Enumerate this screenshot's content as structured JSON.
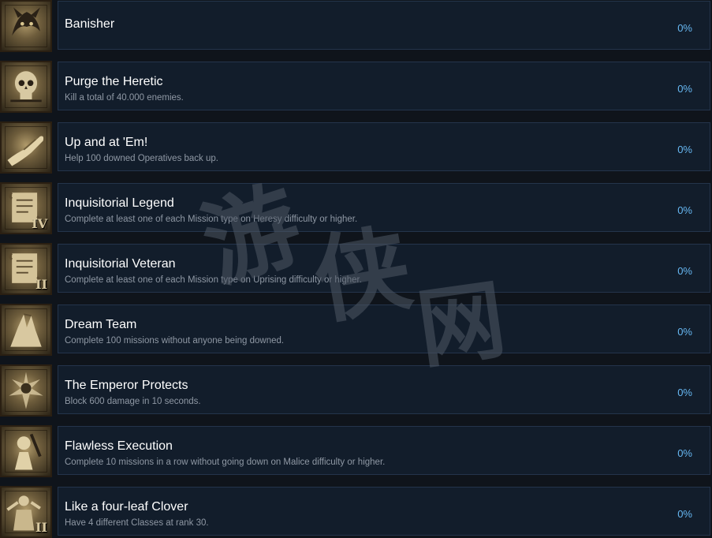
{
  "achievements": [
    {
      "title": "Banisher",
      "description": "",
      "percent": "0%",
      "icon": "daemon-icon",
      "numeral": ""
    },
    {
      "title": "Purge the Heretic",
      "description": "Kill a total of 40.000 enemies.",
      "percent": "0%",
      "icon": "skull-icon",
      "numeral": ""
    },
    {
      "title": "Up and at 'Em!",
      "description": "Help 100 downed Operatives back up.",
      "percent": "0%",
      "icon": "helping-hand-icon",
      "numeral": ""
    },
    {
      "title": "Inquisitorial Legend",
      "description": "Complete at least one of each Mission type on Heresy difficulty or higher.",
      "percent": "0%",
      "icon": "scroll-icon",
      "numeral": "IV"
    },
    {
      "title": "Inquisitorial Veteran",
      "description": "Complete at least one of each Mission type on Uprising difficulty or higher.",
      "percent": "0%",
      "icon": "scroll-icon",
      "numeral": "II"
    },
    {
      "title": "Dream Team",
      "description": "Complete 100 missions without anyone being downed.",
      "percent": "0%",
      "icon": "high-five-icon",
      "numeral": ""
    },
    {
      "title": "The Emperor Protects",
      "description": "Block 600 damage in 10 seconds.",
      "percent": "0%",
      "icon": "emperor-icon",
      "numeral": ""
    },
    {
      "title": "Flawless Execution",
      "description": "Complete 10 missions in a row without going down on Malice difficulty or higher.",
      "percent": "0%",
      "icon": "execution-icon",
      "numeral": ""
    },
    {
      "title": "Like a four-leaf Clover",
      "description": "Have 4 different Classes at rank 30.",
      "percent": "0%",
      "icon": "warrior-icon",
      "numeral": "II"
    }
  ],
  "watermark": {
    "char1": "游",
    "char2": "侠",
    "char3": "网"
  }
}
